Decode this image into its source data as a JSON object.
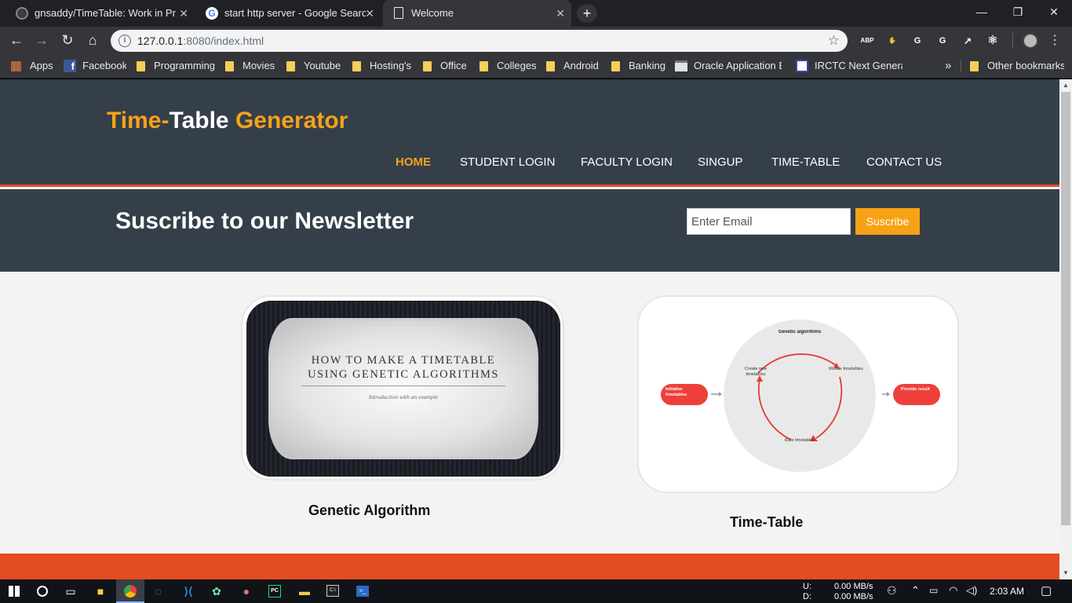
{
  "browser": {
    "tabs": [
      {
        "title": "gnsaddy/TimeTable: Work in Prog",
        "icon": "github-icon",
        "active": false
      },
      {
        "title": "start http server - Google Search",
        "icon": "google-icon",
        "active": false
      },
      {
        "title": "Welcome",
        "icon": "page-icon",
        "active": true
      }
    ],
    "new_tab": "+",
    "window_controls": {
      "minimize": "—",
      "maximize": "❐",
      "close": "✕"
    },
    "url_host": "127.0.0.1",
    "url_rest": ":8080/index.html",
    "extensions": [
      {
        "name": "adblock-plus-icon",
        "label": "ABP",
        "color": "#d32f2f"
      },
      {
        "name": "stop-icon",
        "label": "✋",
        "color": "#d32f2f"
      },
      {
        "name": "grammarly-icon",
        "label": "G",
        "color": "#15c39a"
      },
      {
        "name": "google-translate-icon",
        "label": "G",
        "color": "#4285f4"
      },
      {
        "name": "arrow-extension-icon",
        "label": "↗",
        "color": "#e53935"
      },
      {
        "name": "react-devtools-icon",
        "label": "⚛",
        "color": "#35363a"
      }
    ],
    "bookmarks": [
      {
        "label": "Apps",
        "icon": "apps-grid-icon"
      },
      {
        "label": "Facebook",
        "icon": "facebook-icon"
      },
      {
        "label": "Programming",
        "icon": "folder-icon"
      },
      {
        "label": "Movies",
        "icon": "folder-icon"
      },
      {
        "label": "Youtube",
        "icon": "folder-icon"
      },
      {
        "label": "Hosting's",
        "icon": "folder-icon"
      },
      {
        "label": "Office",
        "icon": "folder-icon"
      },
      {
        "label": "Colleges",
        "icon": "folder-icon"
      },
      {
        "label": "Android",
        "icon": "folder-icon"
      },
      {
        "label": "Banking",
        "icon": "folder-icon"
      },
      {
        "label": "Oracle Application Ex",
        "icon": "oracle-icon"
      },
      {
        "label": "IRCTC Next Generatio",
        "icon": "irctc-icon"
      }
    ],
    "more_bookmarks": "»",
    "other_bookmarks": "Other bookmarks"
  },
  "site": {
    "logo": {
      "part1": "Time-",
      "part2": "Table",
      "part3": " Generator"
    },
    "nav": [
      "HOME",
      "STUDENT LOGIN",
      "FACULTY LOGIN",
      "SINGUP",
      "TIME-TABLE",
      "CONTACT US"
    ],
    "newsletter": {
      "title": "Suscribe to our Newsletter",
      "placeholder": "Enter Email",
      "button": "Suscribe"
    },
    "cards": [
      {
        "caption": "Genetic Algorithm",
        "slide_line1": "HOW TO MAKE A TIMETABLE",
        "slide_line2": "USING GENETIC ALGORITHMS",
        "slide_sub": "Introduction with an example"
      },
      {
        "caption": "Time-Table",
        "diagram": {
          "center": "Genetic algorithms",
          "left": "Initialize timetables",
          "right": "Provide result",
          "create": "Create new timetables",
          "mutate": "Mutate timetables",
          "rate": "Rate timetables"
        }
      }
    ]
  },
  "taskbar": {
    "net_up_label": "U:",
    "net_down_label": "D:",
    "net_up": "0.00 MB/s",
    "net_down": "0.00 MB/s",
    "time": "2:03 AM"
  },
  "colors": {
    "accent": "#f7a216",
    "header": "#343f4a",
    "orange_bar": "#e44c21"
  }
}
